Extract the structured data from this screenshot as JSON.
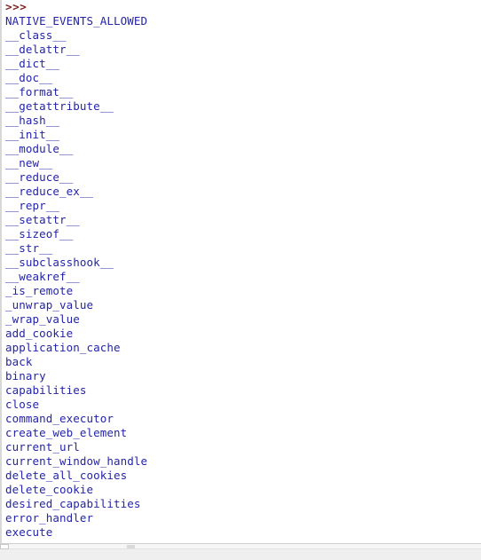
{
  "window": {
    "title": "Python Interactive Console",
    "background_color": "#ffffff"
  },
  "colors": {
    "prompt": "#7d2020",
    "attribute_text": "#2424a8",
    "scrollbar_track": "#f6f6f6",
    "scrollbar_frame": "#efefef",
    "left_gutter": "#d8d8d8"
  },
  "console": {
    "prompt": ">>>",
    "lines": [
      {
        "kind": "prompt",
        "text": ">>>"
      },
      {
        "kind": "attribute",
        "text": "NATIVE_EVENTS_ALLOWED"
      },
      {
        "kind": "attribute",
        "text": "__class__"
      },
      {
        "kind": "attribute",
        "text": "__delattr__"
      },
      {
        "kind": "attribute",
        "text": "__dict__"
      },
      {
        "kind": "attribute",
        "text": "__doc__"
      },
      {
        "kind": "attribute",
        "text": "__format__"
      },
      {
        "kind": "attribute",
        "text": "__getattribute__"
      },
      {
        "kind": "attribute",
        "text": "__hash__"
      },
      {
        "kind": "attribute",
        "text": "__init__"
      },
      {
        "kind": "attribute",
        "text": "__module__"
      },
      {
        "kind": "attribute",
        "text": "__new__"
      },
      {
        "kind": "attribute",
        "text": "__reduce__"
      },
      {
        "kind": "attribute",
        "text": "__reduce_ex__"
      },
      {
        "kind": "attribute",
        "text": "__repr__"
      },
      {
        "kind": "attribute",
        "text": "__setattr__"
      },
      {
        "kind": "attribute",
        "text": "__sizeof__"
      },
      {
        "kind": "attribute",
        "text": "__str__"
      },
      {
        "kind": "attribute",
        "text": "__subclasshook__"
      },
      {
        "kind": "attribute",
        "text": "__weakref__"
      },
      {
        "kind": "attribute",
        "text": "_is_remote"
      },
      {
        "kind": "attribute",
        "text": "_unwrap_value"
      },
      {
        "kind": "attribute",
        "text": "_wrap_value"
      },
      {
        "kind": "attribute",
        "text": "add_cookie"
      },
      {
        "kind": "attribute",
        "text": "application_cache"
      },
      {
        "kind": "attribute",
        "text": "back"
      },
      {
        "kind": "attribute",
        "text": "binary"
      },
      {
        "kind": "attribute",
        "text": "capabilities"
      },
      {
        "kind": "attribute",
        "text": "close"
      },
      {
        "kind": "attribute",
        "text": "command_executor"
      },
      {
        "kind": "attribute",
        "text": "create_web_element"
      },
      {
        "kind": "attribute",
        "text": "current_url"
      },
      {
        "kind": "attribute",
        "text": "current_window_handle"
      },
      {
        "kind": "attribute",
        "text": "delete_all_cookies"
      },
      {
        "kind": "attribute",
        "text": "delete_cookie"
      },
      {
        "kind": "attribute",
        "text": "desired_capabilities"
      },
      {
        "kind": "attribute",
        "text": "error_handler"
      },
      {
        "kind": "attribute",
        "text": "execute"
      }
    ]
  },
  "scrollbar": {
    "orientation": "horizontal",
    "thumb_position": "left"
  }
}
